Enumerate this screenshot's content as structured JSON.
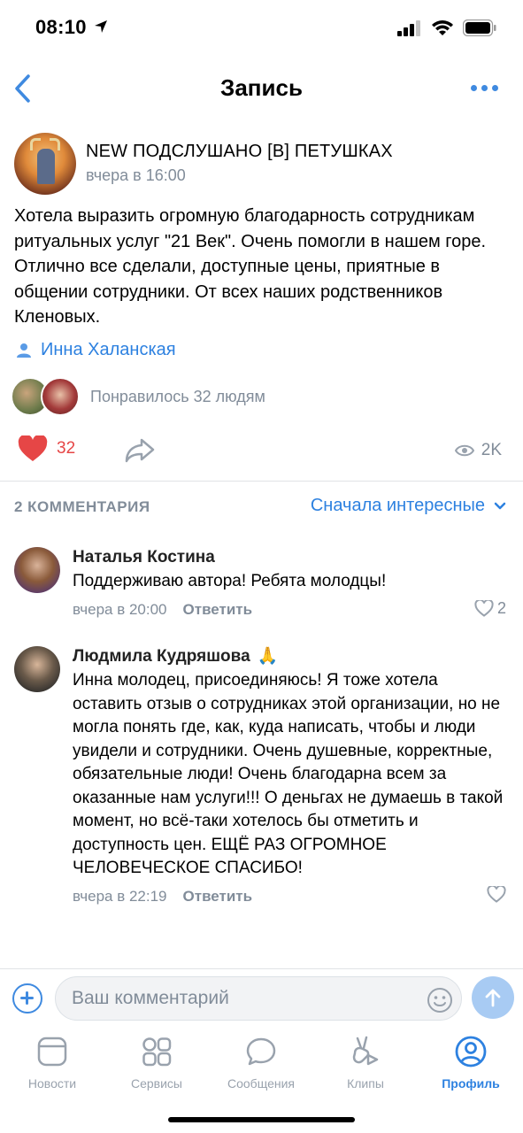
{
  "status_bar": {
    "time": "08:10"
  },
  "nav": {
    "title": "Запись"
  },
  "post": {
    "group_name": "NEW ПОДСЛУШАНО [В] ПЕТУШКАХ",
    "time": "вчера в 16:00",
    "text": "Хотела выразить огромную благодарность сотрудникам ритуальных услуг \"21 Век\". Очень помогли в нашем горе. Отлично все сделали, доступные цены, приятные в общении сотрудники. От всех наших родственников Кленовых.",
    "author": "Инна Халанская",
    "likes_text": "Понравилось 32 людям",
    "like_count": "32",
    "views": "2K"
  },
  "comments_header": {
    "count_label": "2 КОММЕНТАРИЯ",
    "sort_label": "Сначала интересные"
  },
  "comments": [
    {
      "name": "Наталья Костина",
      "text": "Поддерживаю автора! Ребята молодцы!",
      "time": "вчера в 20:00",
      "reply": "Ответить",
      "likes": "2"
    },
    {
      "name": "Людмила Кудряшова",
      "emoji": "🙏",
      "text": "Инна молодец, присоединяюсь! Я тоже хотела оставить отзыв о сотрудниках этой организации, но не могла понять где, как, куда написать, чтобы и люди увидели и сотрудники. Очень душевные, корректные, обязательные люди! Очень благодарна всем за оказанные нам услуги!!! О деньгах не думаешь в такой момент, но всё-таки хотелось бы отметить и доступность цен. ЕЩЁ РАЗ ОГРОМНОЕ ЧЕЛОВЕЧЕСКОЕ СПАСИБО!",
      "time": "вчера в 22:19",
      "reply": "Ответить",
      "likes": ""
    }
  ],
  "input": {
    "placeholder": "Ваш комментарий"
  },
  "tabs": [
    {
      "label": "Новости",
      "icon": "news-icon"
    },
    {
      "label": "Сервисы",
      "icon": "services-icon"
    },
    {
      "label": "Сообщения",
      "icon": "messages-icon"
    },
    {
      "label": "Клипы",
      "icon": "clips-icon"
    },
    {
      "label": "Профиль",
      "icon": "profile-icon"
    }
  ],
  "colors": {
    "accent": "#2d81e0",
    "like": "#e64646",
    "secondary": "#818c99"
  }
}
